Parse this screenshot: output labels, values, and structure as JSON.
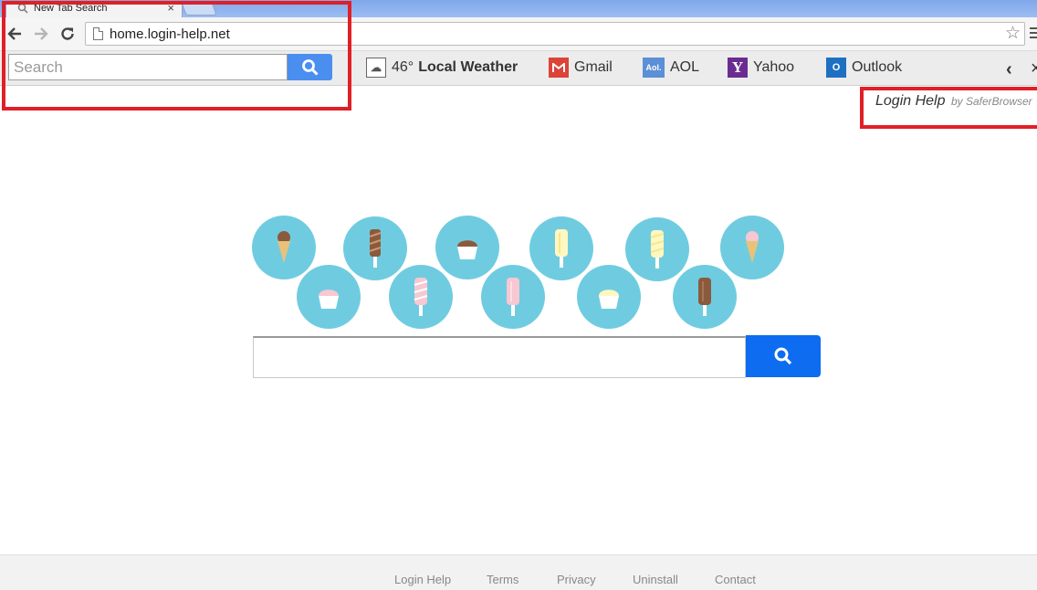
{
  "browser": {
    "tab_title": "New Tab Search",
    "tab_close": "×",
    "url": "home.login-help.net"
  },
  "extension_bar": {
    "search_placeholder": "Search",
    "weather": {
      "temp": "46°",
      "label": "Local Weather"
    },
    "links": [
      {
        "label": "Gmail",
        "icon": "gmail-icon",
        "color": "#db4437"
      },
      {
        "label": "AOL",
        "icon": "aol-icon",
        "icon_text": "Aol.",
        "color": "#5b8fd6"
      },
      {
        "label": "Yahoo",
        "icon": "yahoo-icon",
        "icon_text": "Y",
        "color": "#6b2c91"
      },
      {
        "label": "Outlook",
        "icon": "outlook-icon",
        "icon_text": "O",
        "color": "#1d70c2"
      }
    ]
  },
  "brand": {
    "main": "Login Help",
    "by": "by SaferBrowser"
  },
  "main_search": {
    "placeholder": "",
    "button_icon": "search-icon",
    "button_color": "#0d6cf0"
  },
  "decorations": {
    "circle_color": "#6fcce0",
    "items": [
      "cone",
      "fudge-bar",
      "chocolate-cupcake",
      "yellow-popsicle",
      "yellow-popsicle-2",
      "pink-cone",
      "pink-cupcake",
      "pink-popsicle",
      "pink-popsicle-2",
      "white-cupcake",
      "chocolate-popsicle"
    ]
  },
  "footer": {
    "links": [
      "Login Help",
      "Terms",
      "Privacy",
      "Uninstall",
      "Contact"
    ]
  },
  "highlight_color": "#e01f26"
}
